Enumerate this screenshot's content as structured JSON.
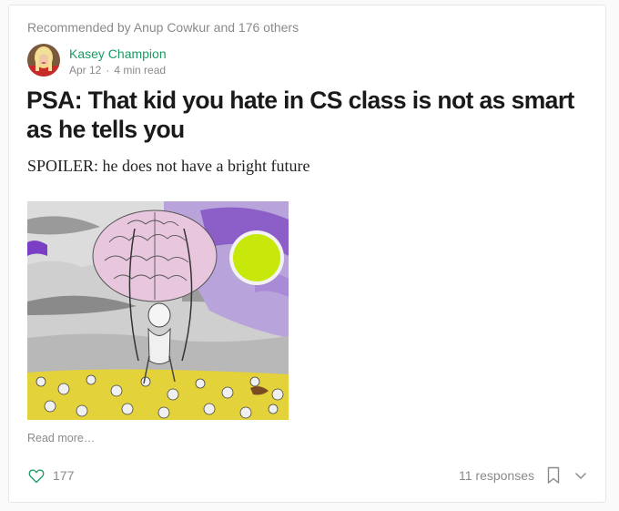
{
  "recommendation": "Recommended by Anup Cowkur and 176 others",
  "author": {
    "name": "Kasey Champion",
    "date": "Apr 12",
    "separator": "·",
    "read_time": "4 min read"
  },
  "post": {
    "title": "PSA: That kid you hate in CS class is not as smart as he tells you",
    "subtitle": "SPOILER: he does not have a bright future",
    "read_more": "Read more…"
  },
  "footer": {
    "claps": "177",
    "responses": "11 responses"
  },
  "colors": {
    "accent": "#1c9963",
    "muted": "#8a8a8a",
    "heart": "#1c9963"
  },
  "icons": {
    "clap": "heart-icon",
    "bookmark": "bookmark-icon",
    "more": "chevron-down-icon"
  }
}
